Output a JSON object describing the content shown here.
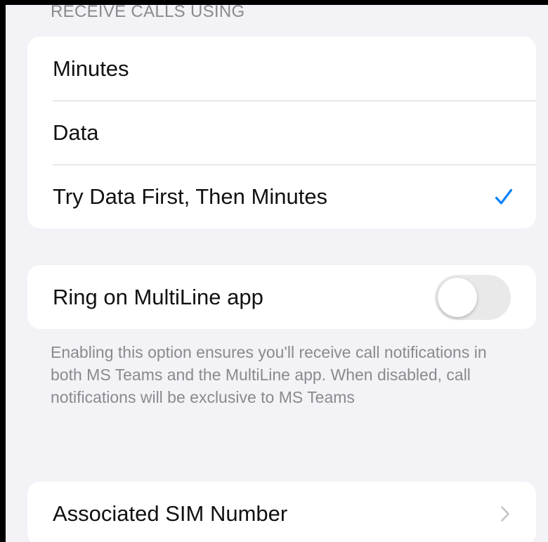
{
  "receive_calls": {
    "header": "RECEIVE CALLS USING",
    "options": [
      {
        "label": "Minutes",
        "selected": false
      },
      {
        "label": "Data",
        "selected": false
      },
      {
        "label": "Try Data First, Then Minutes",
        "selected": true
      }
    ]
  },
  "ring_multiline": {
    "label": "Ring on MultiLine app",
    "enabled": false,
    "footnote": "Enabling this option ensures you'll receive call notifications in both MS Teams and the MultiLine app. When disabled, call notifications will be exclusive to MS Teams"
  },
  "associated_sim": {
    "label": "Associated SIM Number"
  },
  "icons": {
    "check": "checkmark-icon",
    "chevron": "chevron-right-icon"
  },
  "colors": {
    "accent": "#0a84ff",
    "background": "#f2f2f7",
    "card": "#ffffff",
    "secondary_text": "#8a8a8e",
    "toggle_off": "#e9e9ea"
  }
}
